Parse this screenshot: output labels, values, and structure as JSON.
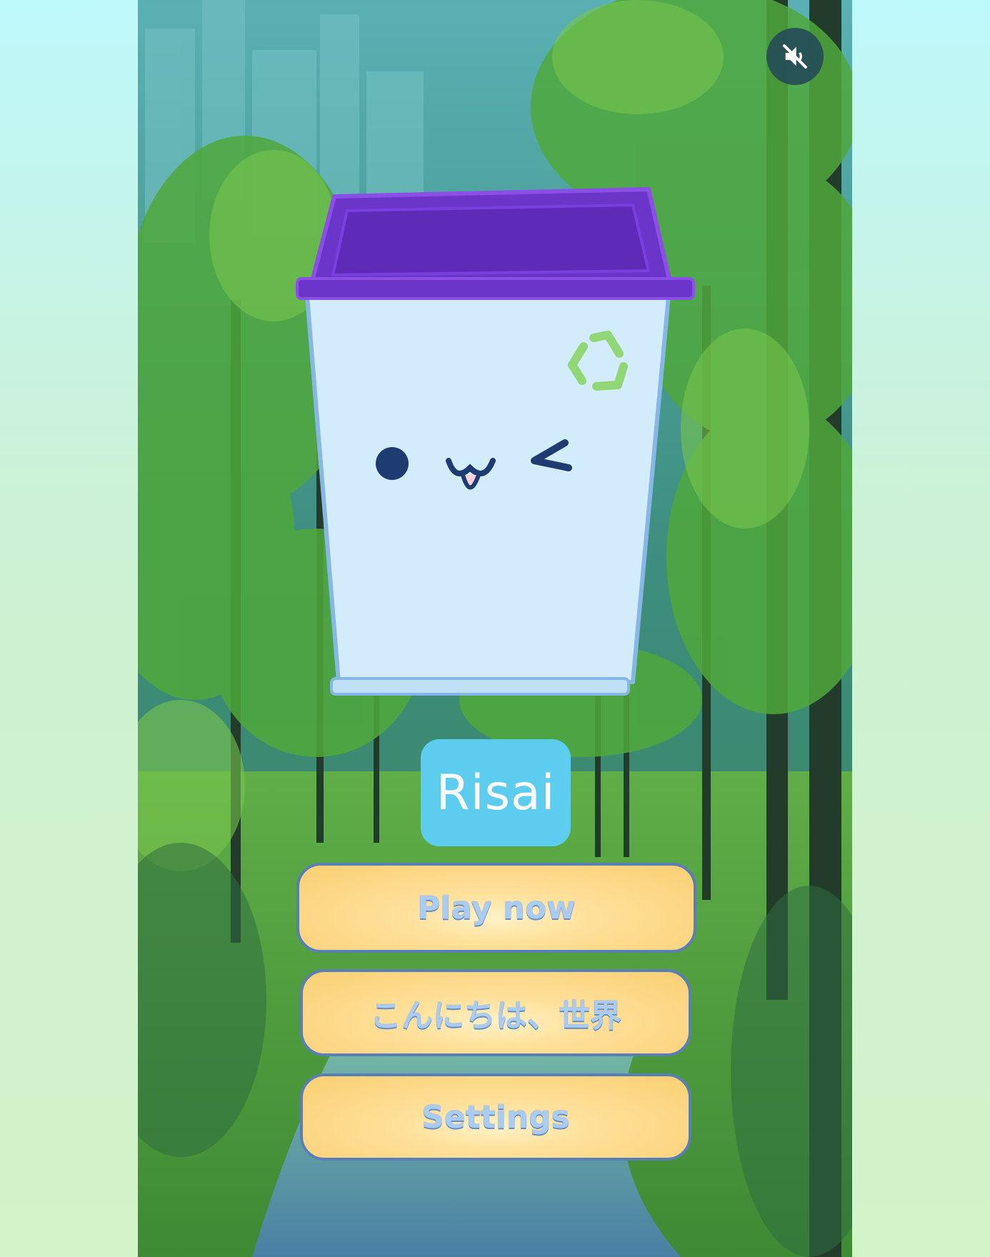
{
  "game": {
    "title": "Risai",
    "mute_icon": "speaker-muted-icon",
    "mascot": "recycling-bin-mascot",
    "recycle_icon": "recycle-icon"
  },
  "menu": {
    "play_label": "Play now",
    "hello_label": "こんにちは、世界",
    "settings_label": "Settings"
  },
  "colors": {
    "bin_lid": "#6b35c9",
    "bin_body": "#d2ecfb",
    "title_badge": "#5ccdee",
    "button_fill": "#fddf95",
    "button_border": "#5a7fb7",
    "recycle": "#8fd66e"
  }
}
